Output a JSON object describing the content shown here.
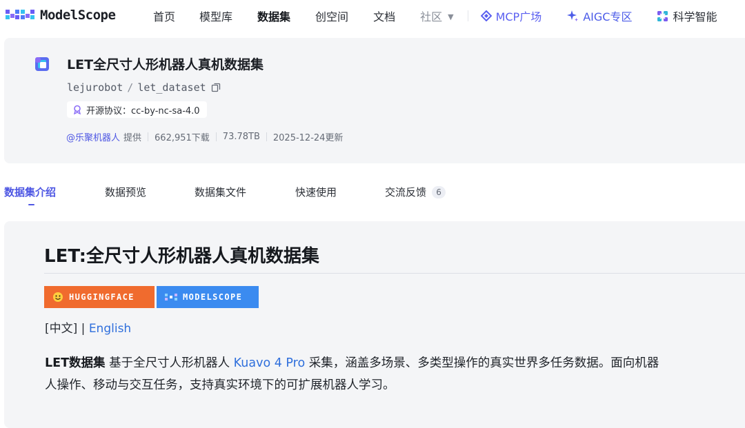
{
  "brand": {
    "name": "ModelScope"
  },
  "nav": {
    "items": [
      {
        "label": "首页"
      },
      {
        "label": "模型库"
      },
      {
        "label": "数据集",
        "active": true
      },
      {
        "label": "创空间"
      },
      {
        "label": "文档"
      },
      {
        "label": "社区"
      }
    ],
    "extras": [
      {
        "label": "MCP广场",
        "icon": "mcp-icon"
      },
      {
        "label": "AIGC专区",
        "icon": "sparkle-icon"
      },
      {
        "label": "科学智能",
        "icon": "science-icon"
      }
    ]
  },
  "dataset": {
    "title": "LET全尺寸人形机器人真机数据集",
    "owner": "lejurobot",
    "path_sep": "/",
    "name": "let_dataset",
    "license_label": "开源协议：cc-by-nc-sa-4.0",
    "org": "@乐聚机器人",
    "provide": "提供",
    "downloads": "662,951下载",
    "size": "73.78TB",
    "updated": "2025-12-24更新"
  },
  "tabs": {
    "items": [
      {
        "label": "数据集介绍",
        "active": true
      },
      {
        "label": "数据预览"
      },
      {
        "label": "数据集文件"
      },
      {
        "label": "快速使用"
      },
      {
        "label": "交流反馈",
        "badge": "6"
      }
    ]
  },
  "readme": {
    "heading": "LET:全尺寸人形机器人真机数据集",
    "badge_hf": "HUGGINGFACE",
    "badge_ms": "MODELSCOPE",
    "lang_current": "[中文]",
    "lang_sep": " | ",
    "lang_link": "English",
    "para_bold": "LET数据集",
    "para_1": " 基于全尺寸人形机器人 ",
    "para_link": "Kuavo 4 Pro",
    "para_2": " 采集，涵盖多场景、多类型操作的真实世界多任务数据。面向机器人操作、移动与交互任务，支持真实环境下的可扩展机器人学习。"
  },
  "colors": {
    "accent": "#4d56e3",
    "link": "#2f6fdc",
    "hf_badge": "#f06b2e",
    "ms_badge": "#3b8bf0",
    "card_bg": "#f4f5f7"
  }
}
